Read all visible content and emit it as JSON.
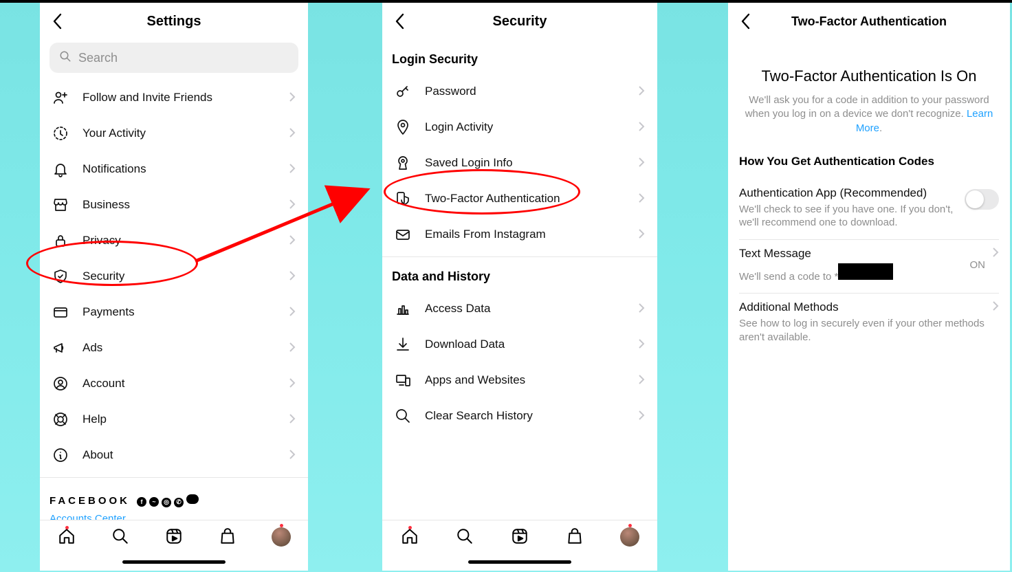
{
  "panel1": {
    "title": "Settings",
    "search_placeholder": "Search",
    "items": [
      {
        "label": "Follow and Invite Friends",
        "icon": "add-user"
      },
      {
        "label": "Your Activity",
        "icon": "activity"
      },
      {
        "label": "Notifications",
        "icon": "bell"
      },
      {
        "label": "Business",
        "icon": "storefront"
      },
      {
        "label": "Privacy",
        "icon": "lock"
      },
      {
        "label": "Security",
        "icon": "shield"
      },
      {
        "label": "Payments",
        "icon": "card"
      },
      {
        "label": "Ads",
        "icon": "megaphone"
      },
      {
        "label": "Account",
        "icon": "user-circle"
      },
      {
        "label": "Help",
        "icon": "lifebuoy"
      },
      {
        "label": "About",
        "icon": "info"
      }
    ],
    "brand": "FACEBOOK",
    "accounts_center": "Accounts Center"
  },
  "panel2": {
    "title": "Security",
    "section1": "Login Security",
    "items1": [
      {
        "label": "Password",
        "icon": "key"
      },
      {
        "label": "Login Activity",
        "icon": "pin"
      },
      {
        "label": "Saved Login Info",
        "icon": "keyhole"
      },
      {
        "label": "Two-Factor Authentication",
        "icon": "device-shield"
      },
      {
        "label": "Emails From Instagram",
        "icon": "mail"
      }
    ],
    "section2": "Data and History",
    "items2": [
      {
        "label": "Access Data",
        "icon": "bar-chart"
      },
      {
        "label": "Download Data",
        "icon": "download"
      },
      {
        "label": "Apps and Websites",
        "icon": "devices"
      },
      {
        "label": "Clear Search History",
        "icon": "search"
      }
    ]
  },
  "panel3": {
    "title": "Two-Factor Authentication",
    "headline": "Two-Factor Authentication Is On",
    "body": "We'll ask you for a code in addition to your password when you log in on a device we don't recognize.",
    "learn_more": "Learn More",
    "section": "How You Get Authentication Codes",
    "auth_app": {
      "title": "Authentication App (Recommended)",
      "desc": "We'll check to see if you have one. If you don't, we'll recommend one to download.",
      "enabled": false
    },
    "sms": {
      "title": "Text Message",
      "desc_prefix": "We'll send a code to *",
      "status": "ON"
    },
    "additional": {
      "title": "Additional Methods",
      "desc": "See how to log in securely even if your other methods aren't available."
    }
  }
}
